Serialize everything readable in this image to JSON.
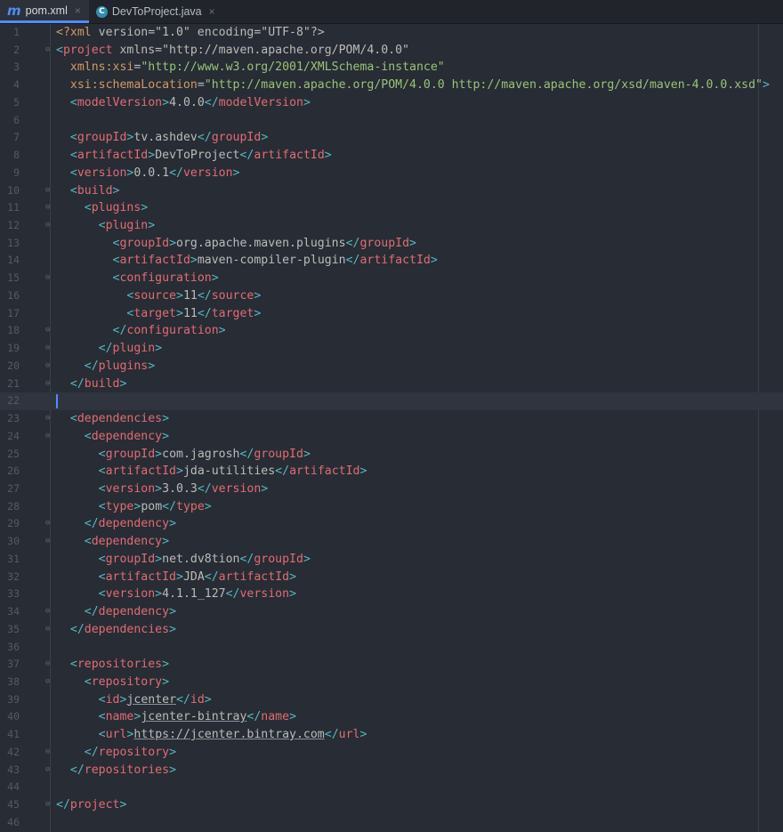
{
  "tabs": [
    {
      "name": "pom.xml",
      "icon": "maven-m-icon",
      "glyph": "m",
      "active": true
    },
    {
      "name": "DevToProject.java",
      "icon": "java-class-icon",
      "glyph": "C",
      "active": false
    }
  ],
  "close_glyph": "×",
  "current_line": 22,
  "colors": {
    "tag": "#e06c75",
    "bracket": "#56b6c2",
    "attr": "#d19a66",
    "string": "#98c379",
    "text": "#bbbbbb",
    "accent": "#528bff"
  },
  "lines": [
    {
      "n": "1",
      "t": "<?xml version=\"1.0\" encoding=\"UTF-8\"?>"
    },
    {
      "n": "2",
      "t": "<project xmlns=\"http://maven.apache.org/POM/4.0.0\""
    },
    {
      "n": "3",
      "t": "  xmlns:xsi=\"http://www.w3.org/2001/XMLSchema-instance\""
    },
    {
      "n": "4",
      "t": "  xsi:schemaLocation=\"http://maven.apache.org/POM/4.0.0 http://maven.apache.org/xsd/maven-4.0.0.xsd\">"
    },
    {
      "n": "5",
      "t": "  <modelVersion>4.0.0</modelVersion>"
    },
    {
      "n": "6",
      "t": ""
    },
    {
      "n": "7",
      "t": "  <groupId>tv.ashdev</groupId>"
    },
    {
      "n": "8",
      "t": "  <artifactId>DevToProject</artifactId>"
    },
    {
      "n": "9",
      "t": "  <version>0.0.1</version>"
    },
    {
      "n": "10",
      "t": "  <build>"
    },
    {
      "n": "11",
      "t": "    <plugins>"
    },
    {
      "n": "12",
      "t": "      <plugin>"
    },
    {
      "n": "13",
      "t": "        <groupId>org.apache.maven.plugins</groupId>"
    },
    {
      "n": "14",
      "t": "        <artifactId>maven-compiler-plugin</artifactId>"
    },
    {
      "n": "15",
      "t": "        <configuration>"
    },
    {
      "n": "16",
      "t": "          <source>11</source>"
    },
    {
      "n": "17",
      "t": "          <target>11</target>"
    },
    {
      "n": "18",
      "t": "        </configuration>"
    },
    {
      "n": "19",
      "t": "      </plugin>"
    },
    {
      "n": "20",
      "t": "    </plugins>"
    },
    {
      "n": "21",
      "t": "  </build>"
    },
    {
      "n": "22",
      "t": ""
    },
    {
      "n": "23",
      "t": "  <dependencies>"
    },
    {
      "n": "24",
      "t": "    <dependency>"
    },
    {
      "n": "25",
      "t": "      <groupId>com.jagrosh</groupId>"
    },
    {
      "n": "26",
      "t": "      <artifactId>jda-utilities</artifactId>"
    },
    {
      "n": "27",
      "t": "      <version>3.0.3</version>"
    },
    {
      "n": "28",
      "t": "      <type>pom</type>"
    },
    {
      "n": "29",
      "t": "    </dependency>"
    },
    {
      "n": "30",
      "t": "    <dependency>"
    },
    {
      "n": "31",
      "t": "      <groupId>net.dv8tion</groupId>"
    },
    {
      "n": "32",
      "t": "      <artifactId>JDA</artifactId>"
    },
    {
      "n": "33",
      "t": "      <version>4.1.1_127</version>"
    },
    {
      "n": "34",
      "t": "    </dependency>"
    },
    {
      "n": "35",
      "t": "  </dependencies>"
    },
    {
      "n": "36",
      "t": ""
    },
    {
      "n": "37",
      "t": "  <repositories>"
    },
    {
      "n": "38",
      "t": "    <repository>"
    },
    {
      "n": "39",
      "t": "      <id>jcenter</id>"
    },
    {
      "n": "40",
      "t": "      <name>jcenter-bintray</name>"
    },
    {
      "n": "41",
      "t": "      <url>https://jcenter.bintray.com</url>"
    },
    {
      "n": "42",
      "t": "    </repository>"
    },
    {
      "n": "43",
      "t": "  </repositories>"
    },
    {
      "n": "44",
      "t": ""
    },
    {
      "n": "45",
      "t": "</project>"
    },
    {
      "n": "46",
      "t": ""
    }
  ]
}
